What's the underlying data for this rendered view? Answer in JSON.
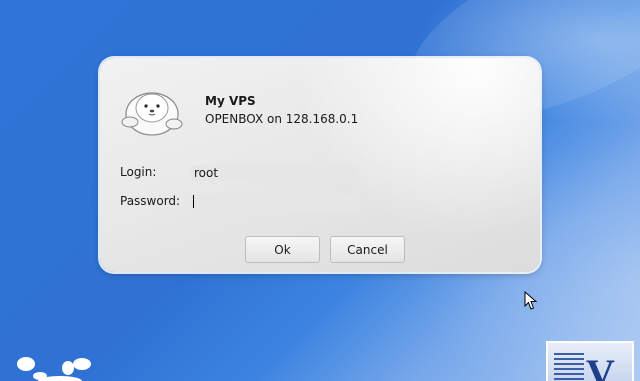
{
  "dialog": {
    "title": "My VPS",
    "subtitle": "OPENBOX on 128.168.0.1",
    "login_label": "Login:",
    "login_value": "root",
    "password_label": "Password:",
    "password_value": "",
    "ok_label": "Ok",
    "cancel_label": "Cancel"
  },
  "desktop": {
    "logo_letter": "V"
  },
  "colors": {
    "desktop_blue": "#2f72d4",
    "dialog_bg": "#e9e9e9",
    "field_bg": "#e6e6e6"
  },
  "icons": [
    "seal-icon",
    "mouse-cursor-icon",
    "v-logo"
  ]
}
